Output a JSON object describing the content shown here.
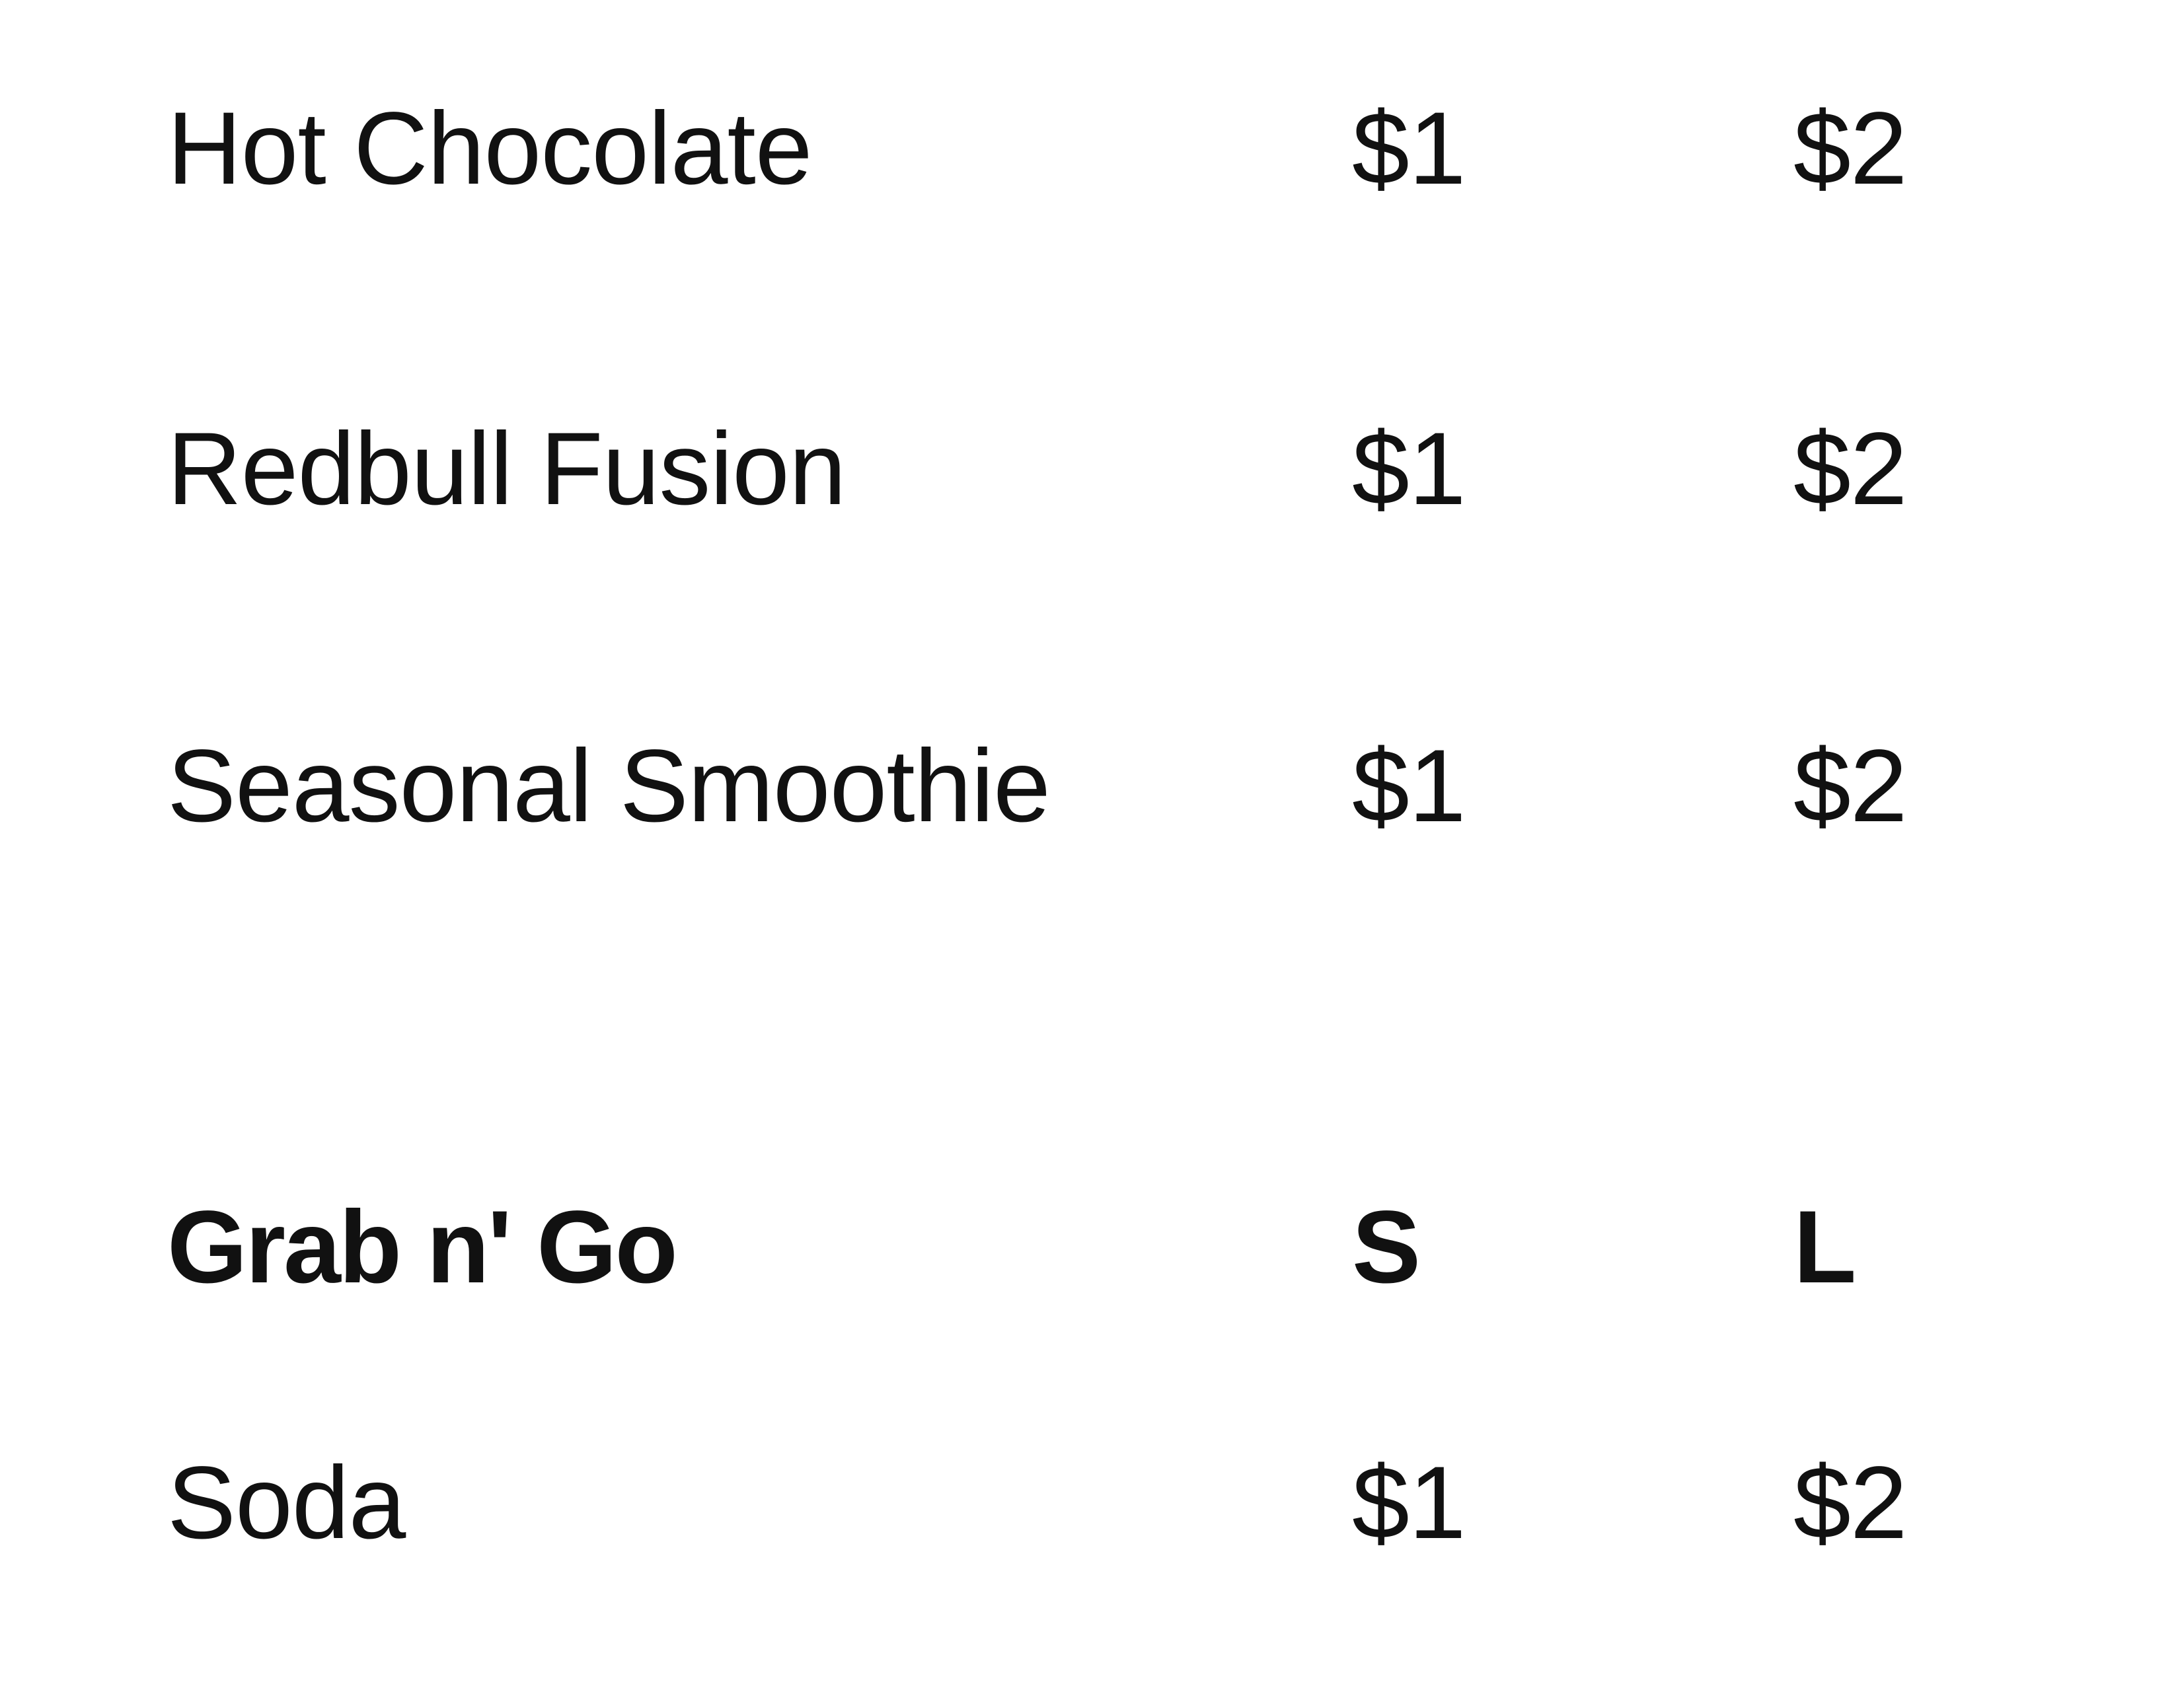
{
  "items_top": [
    {
      "name": "Hot Chocolate",
      "small_price": "$1",
      "large_price": "$2"
    },
    {
      "name": "Redbull Fusion",
      "small_price": "$1",
      "large_price": "$2"
    },
    {
      "name": "Seasonal Smoothie",
      "small_price": "$1",
      "large_price": "$2"
    }
  ],
  "section": {
    "title": "Grab n' Go",
    "small_label": "S",
    "large_label": "L",
    "items": [
      {
        "name": "Soda",
        "small_price": "$1",
        "large_price": "$2"
      }
    ]
  },
  "colors": {
    "text": "#111111",
    "background": "#ffffff"
  }
}
